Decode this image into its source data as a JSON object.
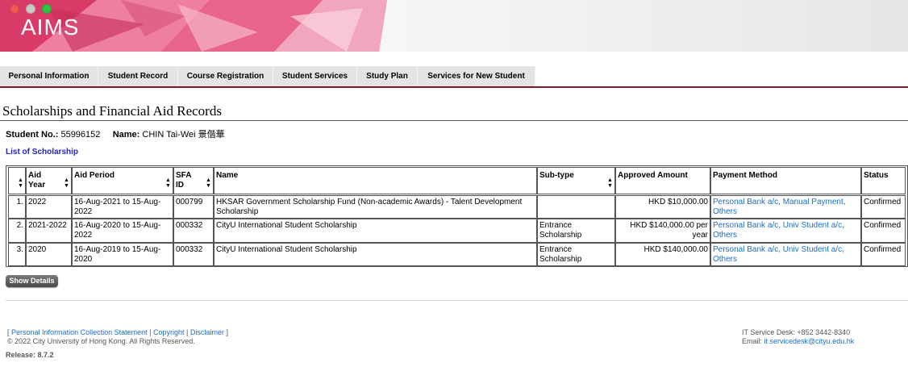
{
  "app": {
    "brand": "AIMS"
  },
  "nav": {
    "tabs": [
      "Personal Information",
      "Student Record",
      "Course Registration",
      "Student Services",
      "Study Plan",
      "Services for New Student"
    ]
  },
  "page": {
    "title": "Scholarships and Financial Aid Records"
  },
  "student": {
    "no_label": "Student No.:",
    "no_value": "55996152",
    "name_label": "Name:",
    "name_value": "CHIN Tai-Wei  景偕華"
  },
  "list_title": "List of Scholarship",
  "table": {
    "headers": [
      "",
      "Aid Year",
      "Aid Period",
      "SFA ID",
      "Name",
      "Sub-type",
      "Approved Amount",
      "Payment Method",
      "Status"
    ],
    "rows": [
      {
        "no": "1.",
        "year": "2022",
        "period": "16-Aug-2021 to 15-Aug-2022",
        "sfa": "000799",
        "name": "HKSAR Government Scholarship Fund (Non-academic Awards) - Talent Development Scholarship",
        "subtype": "",
        "amount": "HKD $10,000.00",
        "payment": "Personal Bank a/c, Manual Payment, Others",
        "status": "Confirmed"
      },
      {
        "no": "2.",
        "year": "2021-2022",
        "period": "16-Aug-2020 to 15-Aug-2022",
        "sfa": "000332",
        "name": "CityU International Student Scholarship",
        "subtype": "Entrance Scholarship",
        "amount": "HKD $140,000.00 per year",
        "payment": "Personal Bank a/c, Univ Student a/c, Others",
        "status": "Confirmed"
      },
      {
        "no": "3.",
        "year": "2020",
        "period": "16-Aug-2019 to 15-Aug-2020",
        "sfa": "000332",
        "name": "CityU International Student Scholarship",
        "subtype": "Entrance Scholarship",
        "amount": "HKD $140,000.00",
        "payment": "Personal Bank a/c, Univ Student a/c, Others",
        "status": "Confirmed"
      }
    ]
  },
  "show_details_label": "Show Details",
  "footer": {
    "bracket_open": "[",
    "bracket_close": "]",
    "sep": "|",
    "links": [
      "Personal Information Collection Statement",
      "Copyright",
      "Disclaimer"
    ],
    "copyright": "© 2022 City University of Hong Kong. All Rights Reserved.",
    "release": "Release: 8.7.2",
    "service_desk": "IT Service Desk: +852 3442-8340",
    "email_label": "Email:",
    "email": "it.servicedesk@cityu.edu.hk"
  },
  "colors": {
    "nav_border": "#7a1b2a",
    "link": "#1a6ec2",
    "list_title": "#2222cc"
  }
}
